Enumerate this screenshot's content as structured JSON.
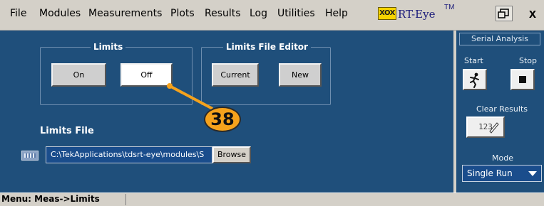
{
  "menubar": {
    "items": [
      "File",
      "Modules",
      "Measurements",
      "Plots",
      "Results",
      "Log",
      "Utilities",
      "Help"
    ],
    "brand_logo": "XOX",
    "brand_name": "RT-Eye",
    "brand_tm": "TM",
    "close_glyph": "x"
  },
  "limits_group": {
    "title": "Limits",
    "on_label": "On",
    "off_label": "Off"
  },
  "editor_group": {
    "title": "Limits File Editor",
    "current_label": "Current",
    "new_label": "New"
  },
  "limits_file": {
    "label": "Limits File",
    "path_value": "C:\\TekApplications\\tdsrt-eye\\modules\\S",
    "browse_label": "Browse"
  },
  "callout": {
    "number": "38",
    "color": "#f5a21c"
  },
  "side_panel": {
    "title": "Serial Analysis",
    "start_label": "Start",
    "stop_label": "Stop",
    "clear_results_label": "Clear Results",
    "clear_button_text": "123",
    "mode_label": "Mode",
    "mode_value": "Single Run"
  },
  "status": {
    "text": "Menu: Meas->Limits"
  },
  "colors": {
    "panel": "#1f4f7b",
    "chrome": "#d4d0c8"
  }
}
